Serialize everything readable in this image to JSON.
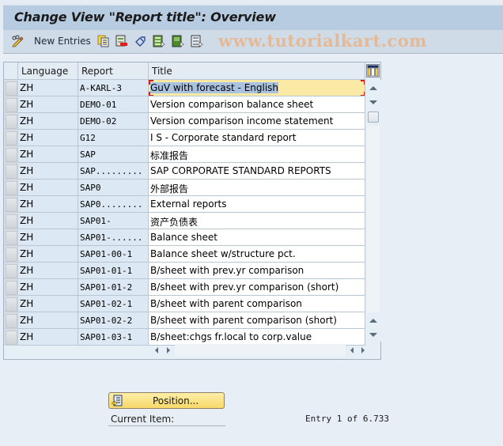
{
  "window": {
    "title": "Change View \"Report title\": Overview"
  },
  "toolbar": {
    "items": [
      {
        "icon": "edit-pencil-icon"
      },
      {
        "label": "New Entries"
      },
      {
        "icon": "copy-icon"
      },
      {
        "icon": "delete-icon"
      },
      {
        "icon": "undo-change-icon"
      },
      {
        "icon": "select-all-icon"
      },
      {
        "icon": "select-block-icon"
      },
      {
        "icon": "deselect-all-icon"
      }
    ],
    "new_entries_label": "New Entries",
    "watermark": "www.tutorialkart.com"
  },
  "table": {
    "columns": [
      "Language",
      "Report",
      "Title"
    ],
    "config_icon": "table-settings-icon",
    "rows": [
      {
        "language": "ZH",
        "report": "A-KARL-3",
        "title": "GuV with forecast - English",
        "focused": true
      },
      {
        "language": "ZH",
        "report": "DEMO-01",
        "title": "Version comparison balance sheet"
      },
      {
        "language": "ZH",
        "report": "DEMO-02",
        "title": "Version comparison income statement"
      },
      {
        "language": "ZH",
        "report": "G12",
        "title": "I S - Corporate standard report"
      },
      {
        "language": "ZH",
        "report": "SAP",
        "title": "标准报告"
      },
      {
        "language": "ZH",
        "report": "SAP.........",
        "title": "SAP CORPORATE STANDARD REPORTS"
      },
      {
        "language": "ZH",
        "report": "SAP0",
        "title": "外部报告"
      },
      {
        "language": "ZH",
        "report": "SAP0........",
        "title": "External reports"
      },
      {
        "language": "ZH",
        "report": "SAP01-",
        "title": "资产负债表"
      },
      {
        "language": "ZH",
        "report": "SAP01-......",
        "title": "Balance sheet"
      },
      {
        "language": "ZH",
        "report": "SAP01-00-1",
        "title": "Balance sheet w/structure pct."
      },
      {
        "language": "ZH",
        "report": "SAP01-01-1",
        "title": "B/sheet with prev.yr comparison"
      },
      {
        "language": "ZH",
        "report": "SAP01-01-2",
        "title": "B/sheet with prev.yr comparison  (short)"
      },
      {
        "language": "ZH",
        "report": "SAP01-02-1",
        "title": "B/sheet with parent comparison"
      },
      {
        "language": "ZH",
        "report": "SAP01-02-2",
        "title": "B/sheet with parent comparison   (short)"
      },
      {
        "language": "ZH",
        "report": "SAP01-03-1",
        "title": "B/sheet:chgs fr.local to corp.value"
      }
    ]
  },
  "footer": {
    "position_button": "Position...",
    "current_item_label": "Current Item:",
    "entry_text": "Entry 1 of 6.733"
  }
}
